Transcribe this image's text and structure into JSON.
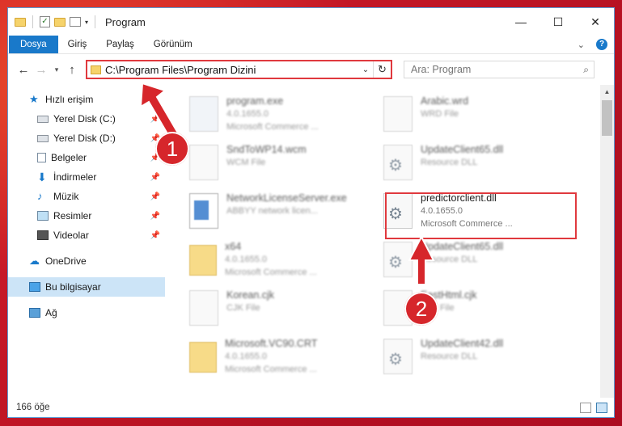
{
  "title": "Program",
  "ribbon": {
    "tabs": [
      "Dosya",
      "Giriş",
      "Paylaş",
      "Görünüm"
    ]
  },
  "address": {
    "path": "C:\\Program Files\\Program Dizini"
  },
  "search": {
    "placeholder": "Ara: Program"
  },
  "sidebar": {
    "items": [
      {
        "label": "Hızlı erişim",
        "icon": "star-icon"
      },
      {
        "label": "Yerel Disk (C:)",
        "icon": "drive-icon"
      },
      {
        "label": "Yerel Disk (D:)",
        "icon": "drive-icon"
      },
      {
        "label": "Belgeler",
        "icon": "document-icon"
      },
      {
        "label": "İndirmeler",
        "icon": "download-icon"
      },
      {
        "label": "Müzik",
        "icon": "music-icon"
      },
      {
        "label": "Resimler",
        "icon": "picture-icon"
      },
      {
        "label": "Videolar",
        "icon": "video-icon"
      },
      {
        "label": "OneDrive",
        "icon": "cloud-icon"
      },
      {
        "label": "Bu bilgisayar",
        "icon": "computer-icon"
      },
      {
        "label": "Ağ",
        "icon": "network-icon"
      }
    ]
  },
  "files": [
    {
      "name": "program.exe",
      "line1": "4.0.1655.0",
      "line2": "Microsoft Commerce ..."
    },
    {
      "name": "Arabic.wrd",
      "line1": "WRD File",
      "line2": ""
    },
    {
      "name": "SndToWP14.wcm",
      "line1": "WCM File",
      "line2": ""
    },
    {
      "name": "UpdateClient65.dll",
      "line1": "Resource DLL",
      "line2": ""
    },
    {
      "name": "NetworkLicenseServer.exe",
      "line1": "ABBYY network licen...",
      "line2": ""
    },
    {
      "name": "predictorclient.dll",
      "line1": "4.0.1655.0",
      "line2": "Microsoft Commerce ..."
    },
    {
      "name": "x64",
      "line1": "4.0.1655.0",
      "line2": "Microsoft Commerce ..."
    },
    {
      "name": "UpdateClient65.dll",
      "line1": "Resource DLL",
      "line2": ""
    },
    {
      "name": "Korean.cjk",
      "line1": "CJK File",
      "line2": ""
    },
    {
      "name": "EastHtml.cjk",
      "line1": "CJK File",
      "line2": ""
    },
    {
      "name": "Microsoft.VC90.CRT",
      "line1": "4.0.1655.0",
      "line2": "Microsoft Commerce ..."
    },
    {
      "name": "UpdateClient42.dll",
      "line1": "Resource DLL",
      "line2": ""
    }
  ],
  "status": {
    "count": "166 öğe"
  },
  "markers": [
    "1",
    "2"
  ],
  "colors": {
    "accent": "#1979ca",
    "highlight": "#e0393e",
    "selected": "#cce4f7"
  }
}
